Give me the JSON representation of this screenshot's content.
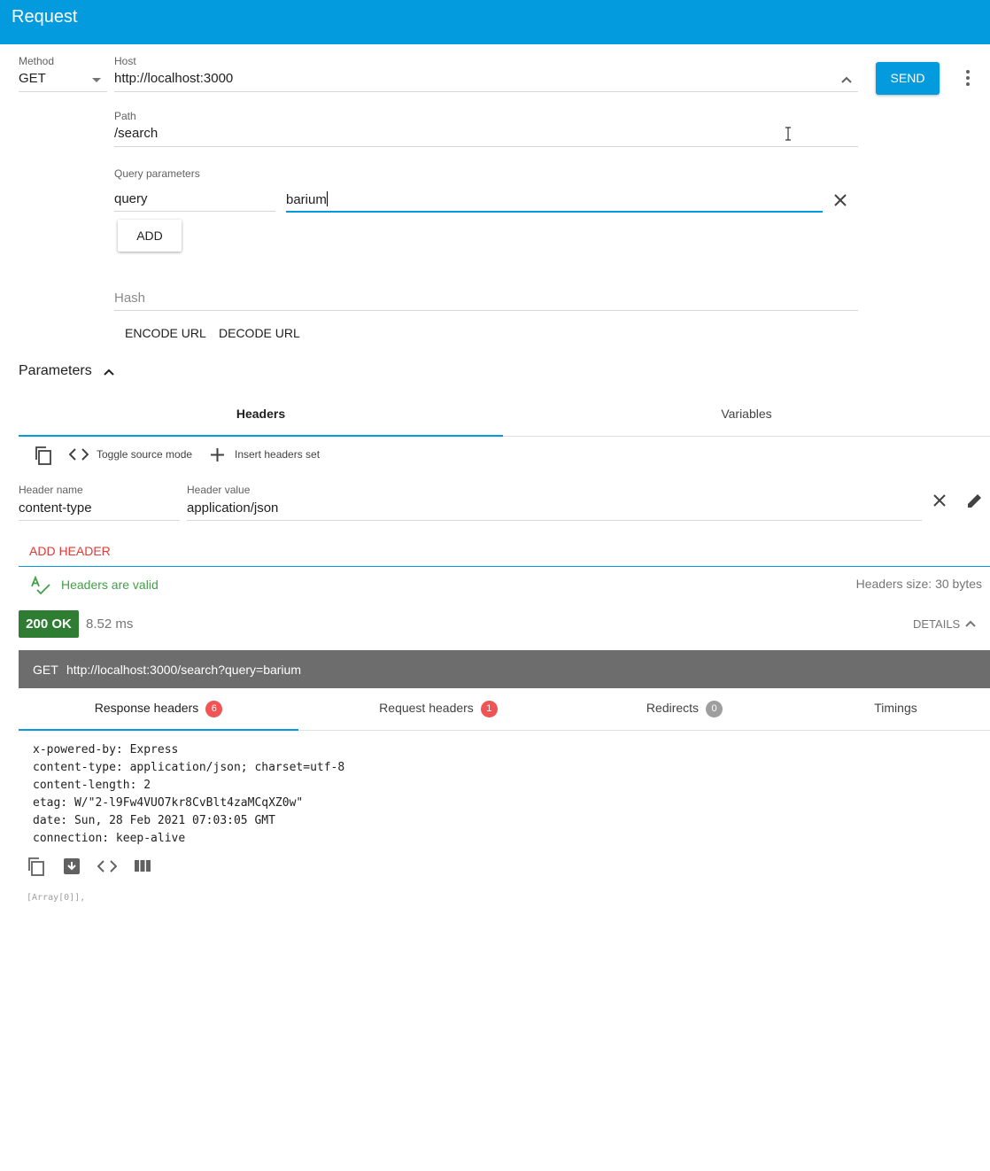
{
  "app": {
    "title": "Request"
  },
  "request": {
    "method_label": "Method",
    "method_value": "GET",
    "host_label": "Host",
    "host_value": "http://localhost:3000",
    "send_label": "SEND",
    "path_label": "Path",
    "path_value": "/search",
    "query_label": "Query parameters",
    "query_params": [
      {
        "name": "query",
        "value": "barium"
      }
    ],
    "add_label": "ADD",
    "hash_placeholder": "Hash",
    "encode_label": "ENCODE URL",
    "decode_label": "DECODE URL"
  },
  "parameters": {
    "title": "Parameters",
    "tabs": [
      {
        "label": "Headers",
        "active": true
      },
      {
        "label": "Variables",
        "active": false
      }
    ],
    "toolbar": {
      "toggle_source": "Toggle source mode",
      "insert_set": "Insert headers set"
    },
    "header_name_label": "Header name",
    "header_value_label": "Header value",
    "headers": [
      {
        "name": "content-type",
        "value": "application/json"
      }
    ],
    "add_header_label": "ADD HEADER",
    "valid_text": "Headers are valid",
    "size_text": "Headers size: 30 bytes"
  },
  "response": {
    "status": "200 OK",
    "time": "8.52 ms",
    "details_label": "DETAILS",
    "method": "GET",
    "url": "http://localhost:3000/search?query=barium",
    "tabs": [
      {
        "label": "Response headers",
        "count": "6",
        "badge_color": "#F05455"
      },
      {
        "label": "Request headers",
        "count": "1",
        "badge_color": "#F05455"
      },
      {
        "label": "Redirects",
        "count": "0",
        "badge_color": "#9E9E9E"
      },
      {
        "label": "Timings",
        "count": ""
      }
    ],
    "headers_lines": [
      "x-powered-by: Express",
      "content-type: application/json; charset=utf-8",
      "content-length: 2",
      "etag: W/\"2-l9Fw4VUO7kr8CvBlt4zaMCqXZ0w\"",
      "date: Sun, 28 Feb 2021 07:03:05 GMT",
      "connection: keep-alive"
    ],
    "body_preview": "[Array[0]],"
  },
  "colors": {
    "accent": "#039BDD",
    "success": "#2E7D32",
    "error": "#E53935",
    "valid": "#43A047"
  }
}
